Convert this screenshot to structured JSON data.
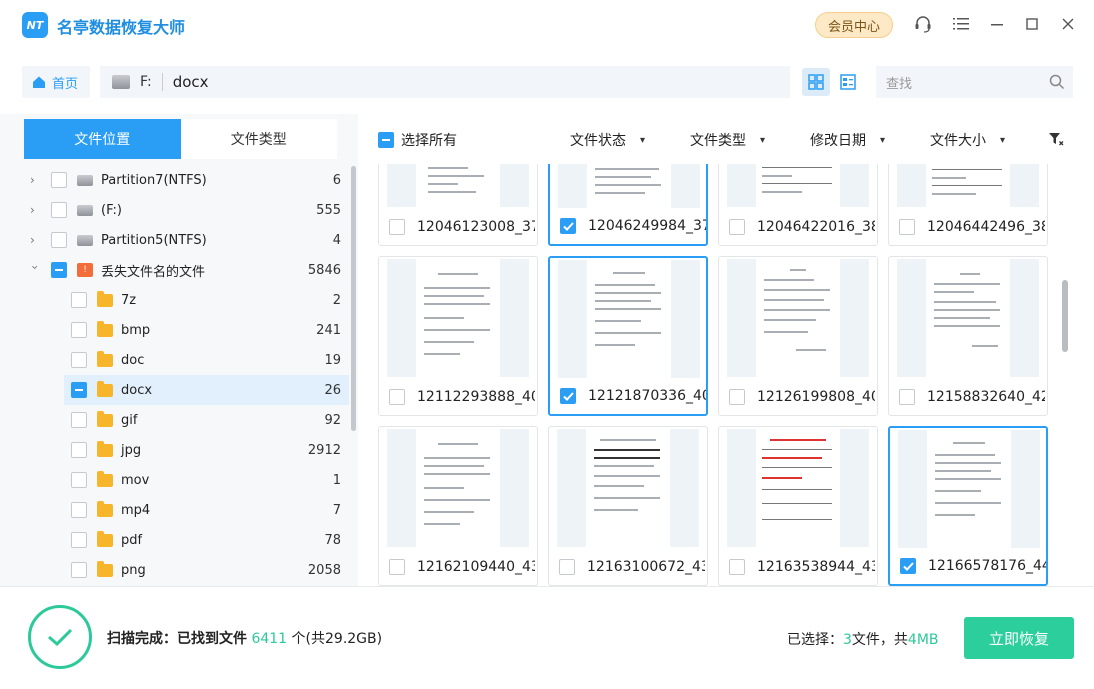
{
  "app": {
    "logo_text": "NT",
    "title": "名亭数据恢复大师",
    "vip_label": "会员中心"
  },
  "address": {
    "home_label": "首页",
    "drive": "F:",
    "folder": "docx",
    "search_placeholder": "查找"
  },
  "left": {
    "tabs": [
      {
        "label": "文件位置",
        "active": true
      },
      {
        "label": "文件类型",
        "active": false
      }
    ],
    "tree": [
      {
        "name": "Partition7(NTFS)",
        "count": "6",
        "type": "drive"
      },
      {
        "name": "(F:)",
        "count": "555",
        "type": "drive"
      },
      {
        "name": "Partition5(NTFS)",
        "count": "4",
        "type": "drive"
      },
      {
        "name": "丢失文件名的文件",
        "count": "5846",
        "type": "lost"
      },
      {
        "name": "7z",
        "count": "2",
        "type": "folder"
      },
      {
        "name": "bmp",
        "count": "241",
        "type": "folder"
      },
      {
        "name": "doc",
        "count": "19",
        "type": "folder"
      },
      {
        "name": "docx",
        "count": "26",
        "type": "folder"
      },
      {
        "name": "gif",
        "count": "92",
        "type": "folder"
      },
      {
        "name": "jpg",
        "count": "2912",
        "type": "folder"
      },
      {
        "name": "mov",
        "count": "1",
        "type": "folder"
      },
      {
        "name": "mp4",
        "count": "7",
        "type": "folder"
      },
      {
        "name": "pdf",
        "count": "78",
        "type": "folder"
      },
      {
        "name": "png",
        "count": "2058",
        "type": "folder"
      }
    ]
  },
  "filters": {
    "select_all": "选择所有",
    "status": "文件状态",
    "type": "文件类型",
    "date": "修改日期",
    "size": "文件大小"
  },
  "files": [
    {
      "name": "12046123008_37",
      "checked": false
    },
    {
      "name": "12046249984_37",
      "checked": true
    },
    {
      "name": "12046422016_38",
      "checked": false
    },
    {
      "name": "12046442496_38",
      "checked": false
    },
    {
      "name": "12112293888_40",
      "checked": false
    },
    {
      "name": "12121870336_40",
      "checked": true
    },
    {
      "name": "12126199808_40",
      "checked": false
    },
    {
      "name": "12158832640_42",
      "checked": false
    },
    {
      "name": "12162109440_43",
      "checked": false
    },
    {
      "name": "12163100672_43",
      "checked": false
    },
    {
      "name": "12163538944_43",
      "checked": false
    },
    {
      "name": "12166578176_44",
      "checked": true
    }
  ],
  "bottom": {
    "status_prefix": "扫描完成：已找到文件",
    "found_count": "6411",
    "status_suffix": "个(共29.2GB)",
    "selected_prefix": "已选择：",
    "selected_count": "3",
    "selected_mid": "文件，共",
    "selected_size": "4MB",
    "recover_label": "立即恢复"
  },
  "colors": {
    "accent": "#2a9df4",
    "success": "#2cc99a",
    "folder": "#f7b52c"
  }
}
